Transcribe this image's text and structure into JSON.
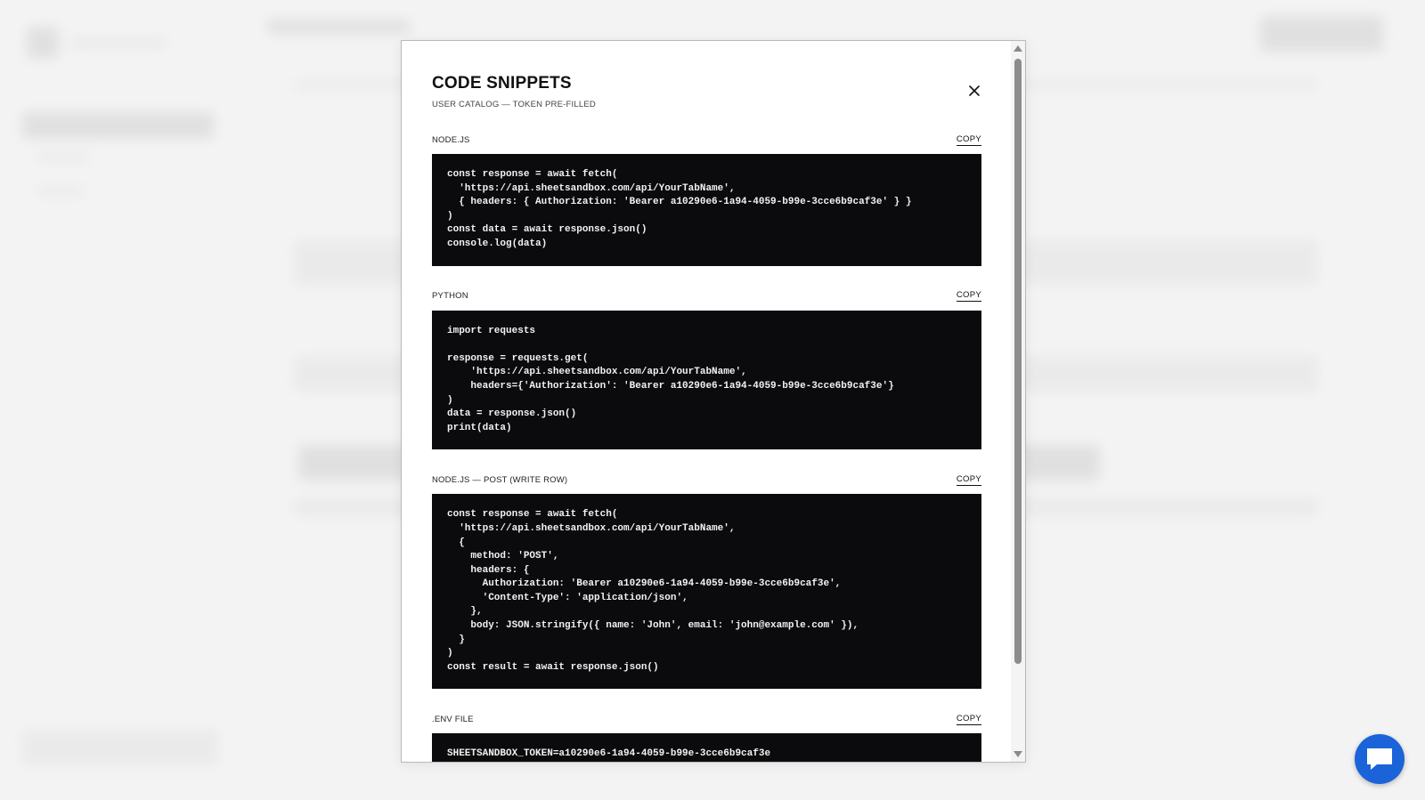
{
  "modal": {
    "title": "CODE SNIPPETS",
    "subtitle": "USER CATALOG — TOKEN PRE-FILLED",
    "close_icon": "close-icon",
    "copy_label": "COPY",
    "snippets": [
      {
        "language": "NODE.JS",
        "code": "const response = await fetch(\n  'https://api.sheetsandbox.com/api/YourTabName',\n  { headers: { Authorization: 'Bearer a10290e6-1a94-4059-b99e-3cce6b9caf3e' } }\n)\nconst data = await response.json()\nconsole.log(data)"
      },
      {
        "language": "PYTHON",
        "code": "import requests\n\nresponse = requests.get(\n    'https://api.sheetsandbox.com/api/YourTabName',\n    headers={'Authorization': 'Bearer a10290e6-1a94-4059-b99e-3cce6b9caf3e'}\n)\ndata = response.json()\nprint(data)"
      },
      {
        "language": "NODE.JS — POST (WRITE ROW)",
        "code": "const response = await fetch(\n  'https://api.sheetsandbox.com/api/YourTabName',\n  {\n    method: 'POST',\n    headers: {\n      Authorization: 'Bearer a10290e6-1a94-4059-b99e-3cce6b9caf3e',\n      'Content-Type': 'application/json',\n    },\n    body: JSON.stringify({ name: 'John', email: 'john@example.com' }),\n  }\n)\nconst result = await response.json()"
      },
      {
        "language": ".ENV FILE",
        "code": "SHEETSANDBOX_TOKEN=a10290e6-1a94-4059-b99e-3cce6b9caf3e"
      }
    ]
  },
  "chat": {
    "icon": "chat-bubble-icon",
    "color": "#1b63d8"
  },
  "colors": {
    "code_bg": "#0b0b0d",
    "code_fg": "#f2f2f2"
  }
}
